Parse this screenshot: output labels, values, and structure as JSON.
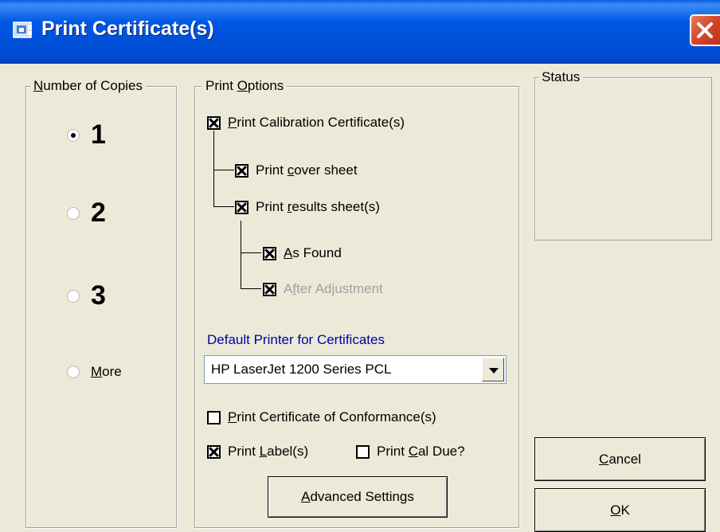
{
  "window": {
    "title": "Print Certificate(s)",
    "icon": "printer-app-icon",
    "close_icon": "close-icon"
  },
  "copies": {
    "legend_pre": "",
    "legend_ul": "N",
    "legend_post": "umber of Copies",
    "options": [
      {
        "label": "1",
        "checked": true
      },
      {
        "label": "2",
        "checked": false
      },
      {
        "label": "3",
        "checked": false
      },
      {
        "label_ul": "M",
        "label_rest": "ore",
        "checked": false
      }
    ]
  },
  "print_options": {
    "legend_pre": "Print ",
    "legend_ul": "O",
    "legend_post": "ptions",
    "cal_cert": {
      "pre": "",
      "ul": "P",
      "post": "rint Calibration Certificate(s)",
      "checked": true
    },
    "cover_sheet": {
      "pre": "Print ",
      "ul": "c",
      "post": "over sheet",
      "checked": true
    },
    "results_sheet": {
      "pre": "Print ",
      "ul": "r",
      "post": "esults sheet(s)",
      "checked": true
    },
    "as_found": {
      "pre": "",
      "ul": "A",
      "post": "s Found",
      "checked": true
    },
    "after_adjustment": {
      "pre": "A",
      "ul": "f",
      "post": "ter Adjustment",
      "checked": true,
      "disabled": true
    },
    "printer_label": "Default Printer for Certificates",
    "printer_value": "HP LaserJet 1200 Series PCL",
    "conformance": {
      "pre": "",
      "ul": "P",
      "post": "rint Certificate of Conformance(s)",
      "checked": false
    },
    "label": {
      "pre": "Print ",
      "ul": "L",
      "post": "abel(s)",
      "checked": true
    },
    "cal_due": {
      "pre": "Print ",
      "ul": "C",
      "post": "al Due?",
      "checked": false
    },
    "advanced": {
      "pre": "",
      "ul": "A",
      "post": "dvanced Settings"
    }
  },
  "status": {
    "legend": "Status"
  },
  "buttons": {
    "cancel": {
      "ul": "C",
      "post": "ancel"
    },
    "ok": {
      "ul": "O",
      "post": "K"
    }
  }
}
